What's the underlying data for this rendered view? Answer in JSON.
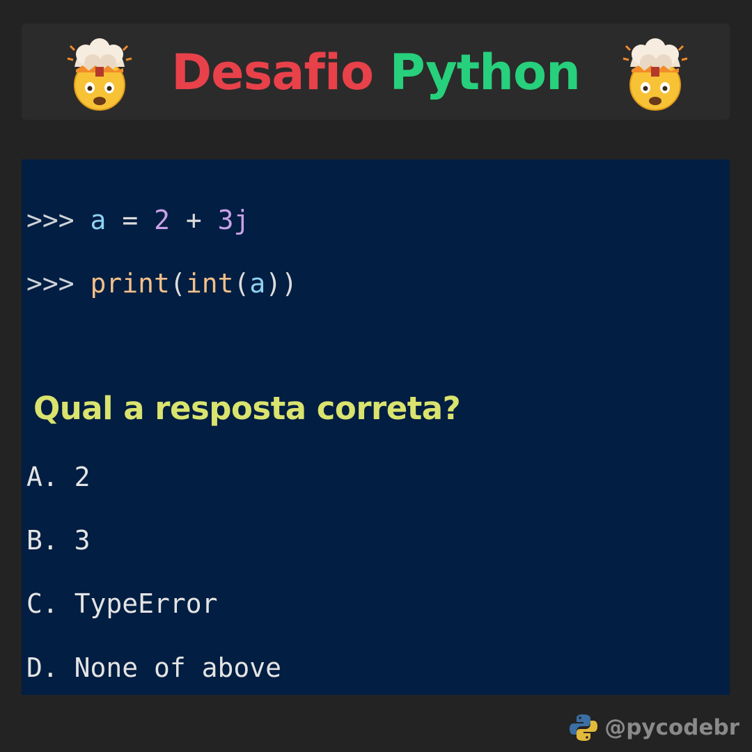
{
  "header": {
    "title_word1": "Desafio",
    "title_word2": "Python",
    "left_icon": "exploding-head-icon",
    "right_icon": "exploding-head-icon",
    "colors": {
      "word1": "#e8414a",
      "word2": "#27d07c"
    }
  },
  "code": {
    "line1": {
      "prompt": ">>>",
      "var": "a",
      "eq": "=",
      "num1": "2",
      "plus": "+",
      "num2": "3j"
    },
    "line2": {
      "prompt": ">>>",
      "fn_print": "print",
      "open1": "(",
      "fn_int": "int",
      "open2": "(",
      "arg": "a",
      "close": "))"
    }
  },
  "question": "Qual a resposta correta?",
  "options": [
    "A. 2",
    "B. 3",
    "C. TypeError",
    "D. None of above"
  ],
  "footer": {
    "logo_icon": "python-logo-icon",
    "handle": "@pycodebr"
  },
  "colors": {
    "background": "#232323",
    "panel": "#021e42",
    "question": "#d9e36e"
  }
}
